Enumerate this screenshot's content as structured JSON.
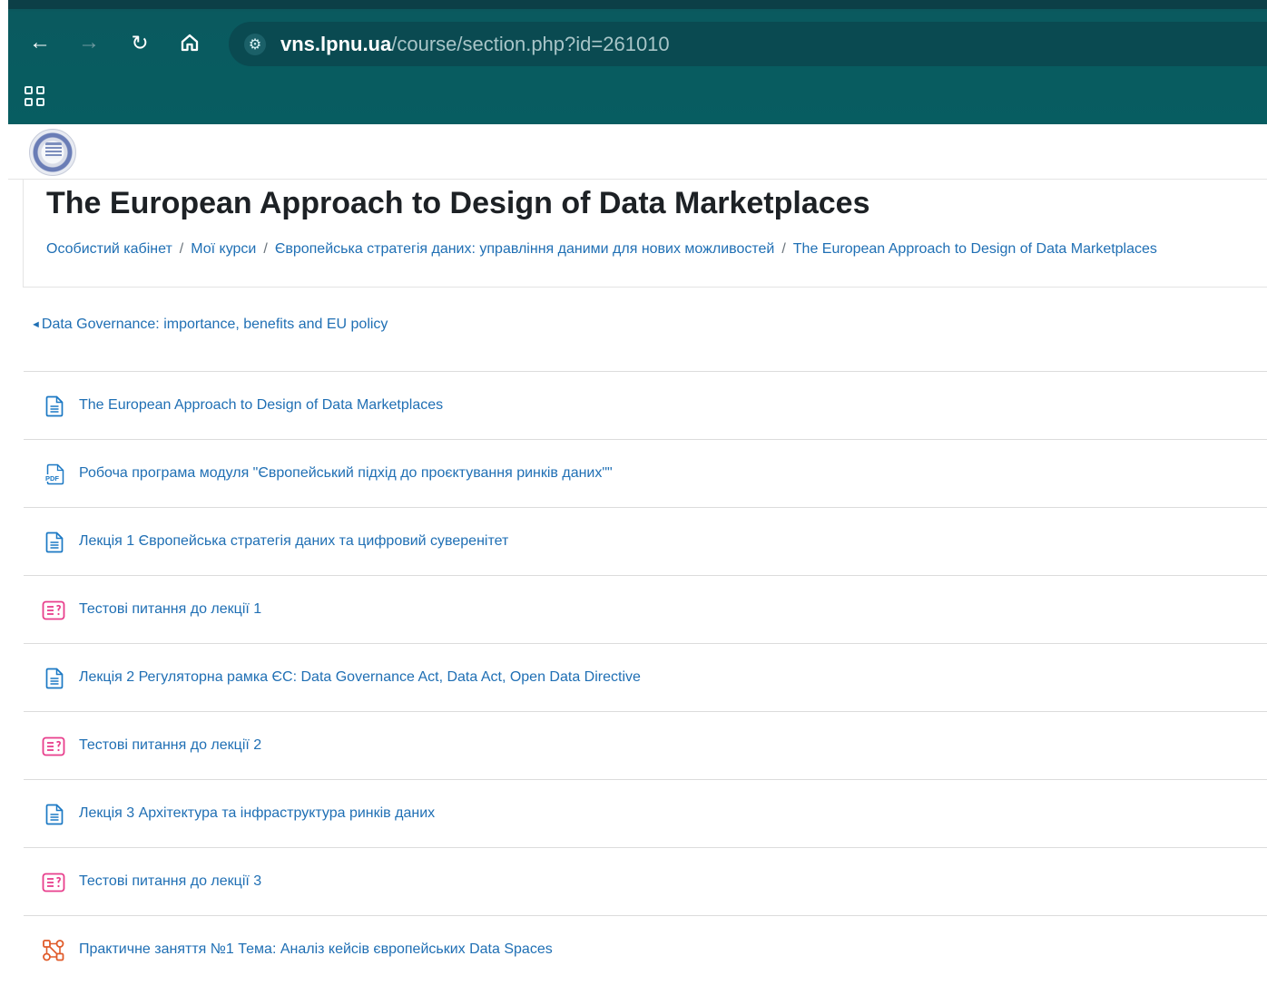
{
  "browser": {
    "url_host": "vns.lpnu.ua",
    "url_path": "/course/section.php?id=261010"
  },
  "page": {
    "title": "The European Approach to Design of Data Marketplaces",
    "breadcrumb": [
      "Особистий кабінет",
      "Мої курси",
      "Європейська стратегія даних: управління даними для нових можливостей",
      "The European Approach to Design of Data Marketplaces"
    ],
    "breadcrumb_separator": "/",
    "prev_section": "Data Governance: importance, benefits and EU policy"
  },
  "activities": [
    {
      "type": "page",
      "icon": "page-icon",
      "label": "The European Approach to Design of Data Marketplaces"
    },
    {
      "type": "pdf",
      "icon": "pdf-icon",
      "label": "Робоча програма модуля \"Європейський підхід до проєктування ринків даних\"\""
    },
    {
      "type": "page",
      "icon": "page-icon",
      "label": "Лекція 1 Європейська стратегія даних та цифровий суверенітет"
    },
    {
      "type": "quiz",
      "icon": "quiz-icon",
      "label": "Тестові питання до лекції 1"
    },
    {
      "type": "page",
      "icon": "page-icon",
      "label": "Лекція 2 Регуляторна рамка ЄС: Data Governance Act, Data Act, Open Data Directive"
    },
    {
      "type": "quiz",
      "icon": "quiz-icon",
      "label": "Тестові питання до лекції 2"
    },
    {
      "type": "page",
      "icon": "page-icon",
      "label": "Лекція 3 Архітектура та інфраструктура ринків даних"
    },
    {
      "type": "quiz",
      "icon": "quiz-icon",
      "label": "Тестові питання до лекції 3"
    },
    {
      "type": "workshop",
      "icon": "workshop-icon",
      "label": "Практичне заняття №1 Тема: Аналіз кейсів європейських Data Spaces"
    }
  ],
  "colors": {
    "browser_bar": "#075d61",
    "link": "#1f6fb4",
    "page_icon": "#1b78c4",
    "quiz_icon": "#e83e8c",
    "workshop_icon": "#e05b2a"
  }
}
